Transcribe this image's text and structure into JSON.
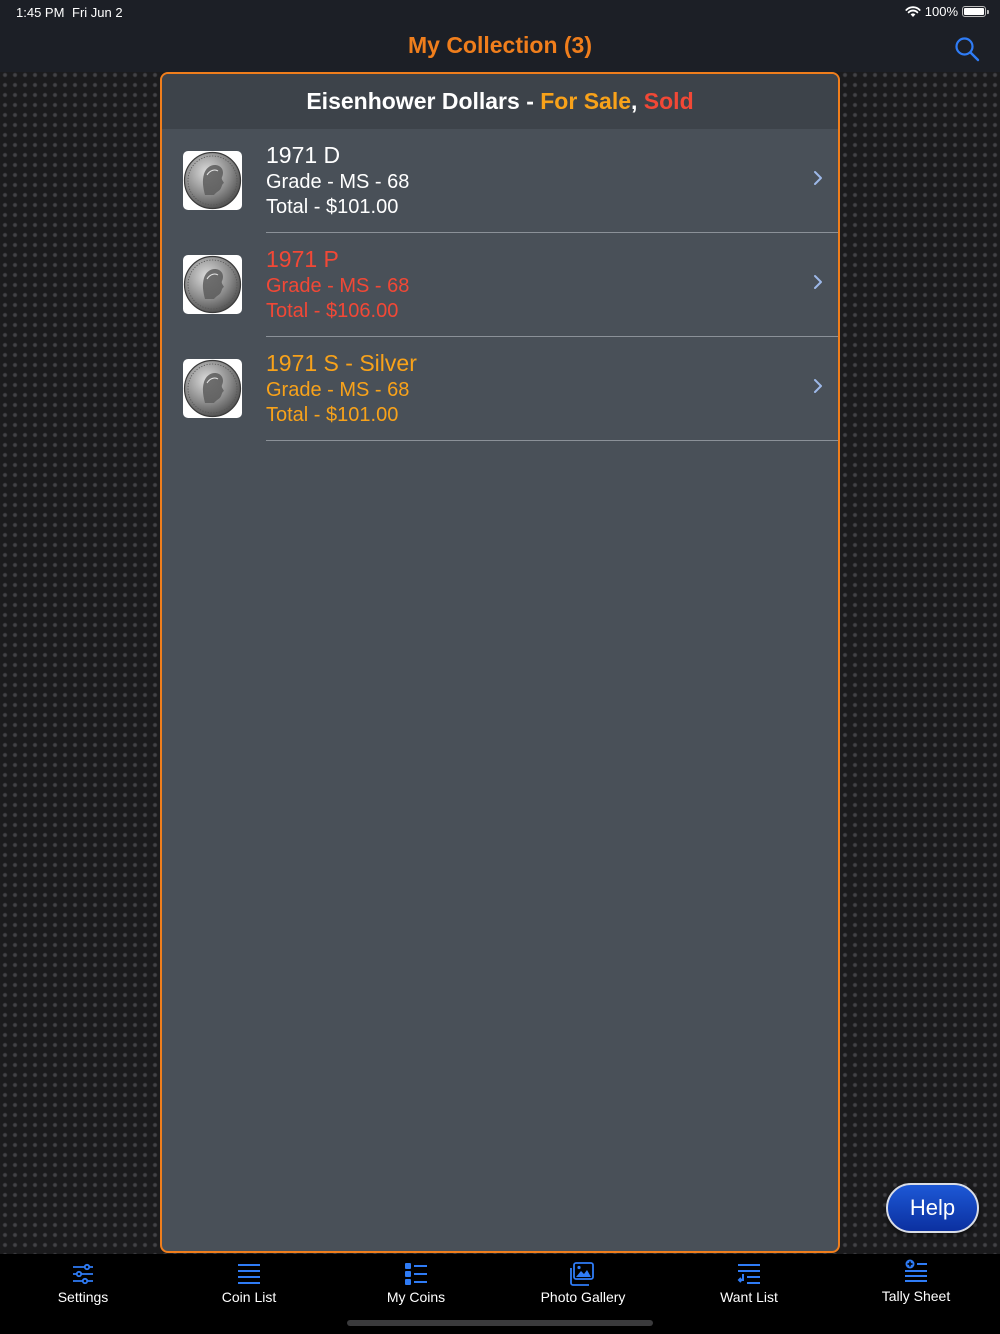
{
  "status": {
    "time": "1:45 PM",
    "date": "Fri Jun 2",
    "battery": "100%"
  },
  "nav": {
    "title": "My Collection (3)",
    "search_icon": "search-icon"
  },
  "header": {
    "title": "Eisenhower Dollars - ",
    "for_sale": "For Sale",
    "comma": ",",
    "sold": " Sold"
  },
  "colors": {
    "accent": "#f07e1c",
    "for_sale": "#f8a21a",
    "sold": "#f24836",
    "normal": "#ffffff",
    "link_blue": "#2f7cf6"
  },
  "coins": [
    {
      "title": "1971 D",
      "grade": "Grade - MS - 68",
      "total": "Total - $101.00",
      "status": "normal"
    },
    {
      "title": "1971 P",
      "grade": "Grade - MS - 68",
      "total": "Total - $106.00",
      "status": "sold"
    },
    {
      "title": "1971 S - Silver",
      "grade": "Grade - MS - 68",
      "total": "Total - $101.00",
      "status": "for_sale"
    }
  ],
  "help": {
    "label": "Help"
  },
  "tabs": [
    {
      "label": "Settings",
      "icon": "sliders-icon"
    },
    {
      "label": "Coin List",
      "icon": "list-icon"
    },
    {
      "label": "My Coins",
      "icon": "bullet-list-icon"
    },
    {
      "label": "Photo Gallery",
      "icon": "photo-gallery-icon"
    },
    {
      "label": "Want List",
      "icon": "want-list-icon"
    },
    {
      "label": "Tally Sheet",
      "icon": "tally-sheet-icon"
    }
  ]
}
